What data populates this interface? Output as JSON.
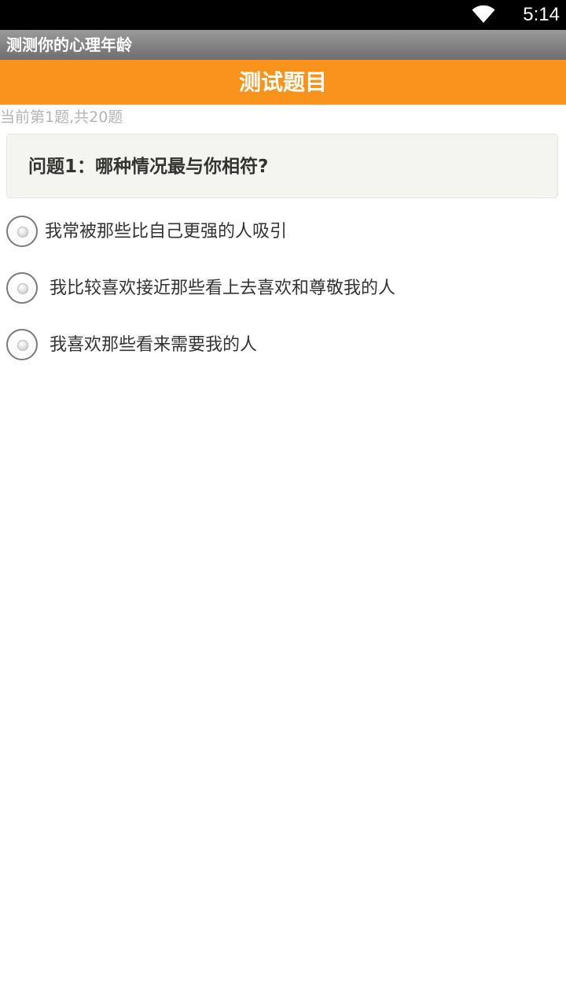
{
  "status_bar": {
    "time": "5:14",
    "wifi_icon": "wifi-icon"
  },
  "app": {
    "title": "测测你的心理年龄"
  },
  "header": {
    "title": "测试题目",
    "color": "#fa931b"
  },
  "progress": {
    "text": "当前第1题,共20题",
    "current": 1,
    "total": 20
  },
  "question": {
    "text": "问题1：哪种情况最与你相符?"
  },
  "options": [
    {
      "label": "我常被那些比自己更强的人吸引",
      "selected": false
    },
    {
      "label": "我比较喜欢接近那些看上去喜欢和尊敬我的人",
      "selected": false
    },
    {
      "label": "我喜欢那些看来需要我的人",
      "selected": false
    }
  ]
}
